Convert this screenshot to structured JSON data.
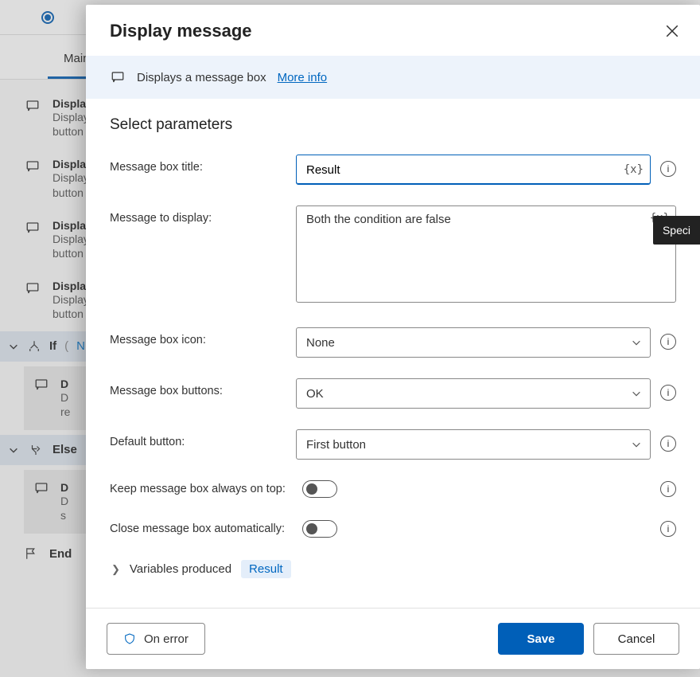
{
  "bg": {
    "tab_label": "Main",
    "steps": [
      {
        "title": "Displa",
        "sub1": "Display",
        "sub2": "button"
      },
      {
        "title": "Displa",
        "sub1": "Display",
        "sub2": "button"
      },
      {
        "title": "Displa",
        "sub1": "Display",
        "sub2": "button"
      },
      {
        "title": "Displa",
        "sub1": "Display",
        "sub2": "button"
      }
    ],
    "if_kw": "If",
    "if_open": "(",
    "if_var": "N",
    "nested": {
      "title": "D",
      "sub1": "D",
      "sub2": "re"
    },
    "else_kw": "Else",
    "nested2": {
      "title": "D",
      "sub1": "D",
      "sub2": "s"
    },
    "end_kw": "End"
  },
  "modal": {
    "title": "Display message",
    "info_text": "Displays a message box",
    "more_info": "More info",
    "section": "Select parameters",
    "labels": {
      "title": "Message box title:",
      "message": "Message to display:",
      "icon": "Message box icon:",
      "buttons": "Message box buttons:",
      "default_btn": "Default button:",
      "on_top": "Keep message box always on top:",
      "auto_close": "Close message box automatically:"
    },
    "values": {
      "title": "Result",
      "message": "Both the condition are false",
      "icon": "None",
      "buttons": "OK",
      "default_btn": "First button"
    },
    "var_token": "{x}",
    "tooltip_hint": "Speci",
    "vars_produced_label": "Variables produced",
    "vars_produced_value": "Result",
    "footer": {
      "on_error": "On error",
      "save": "Save",
      "cancel": "Cancel"
    }
  }
}
